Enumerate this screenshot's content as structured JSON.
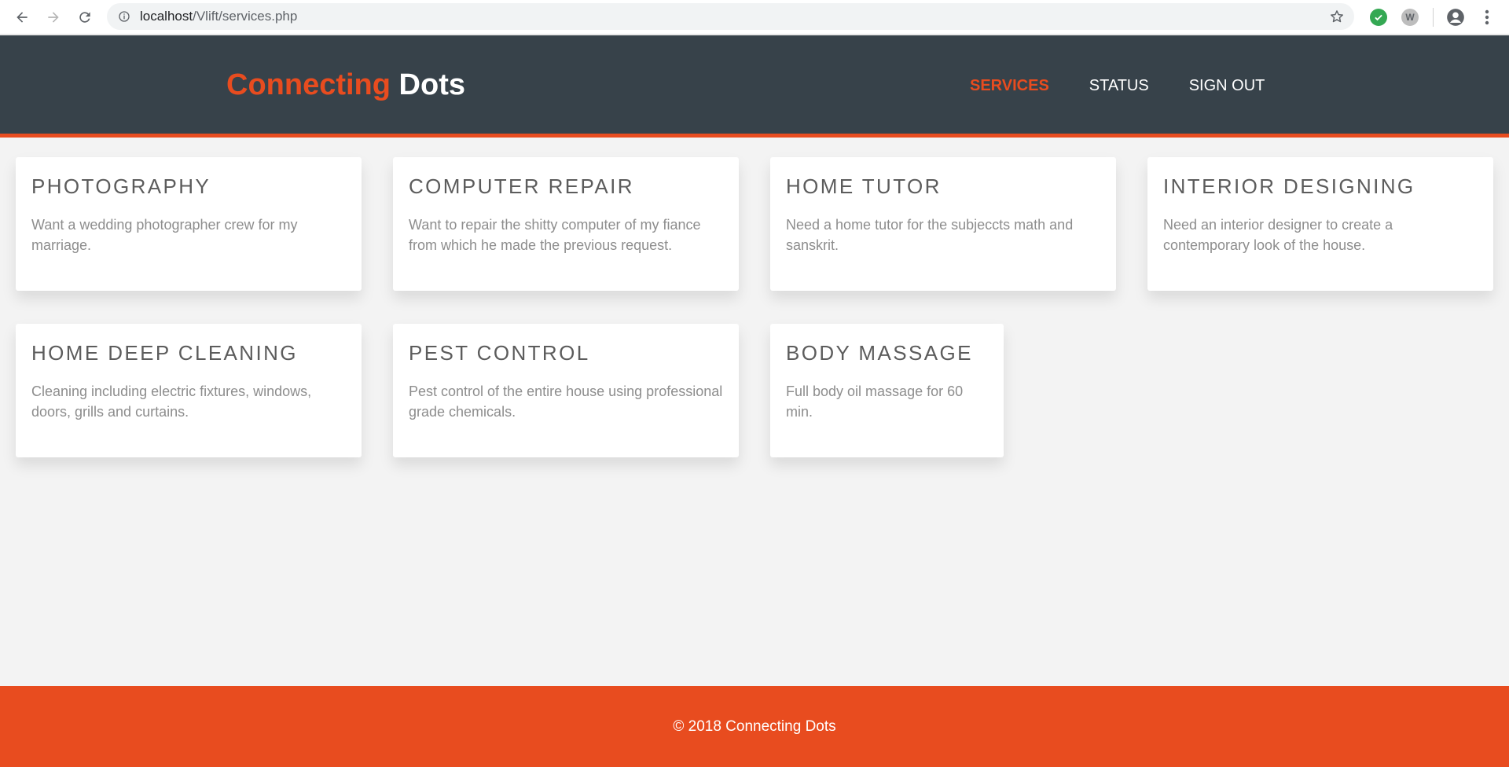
{
  "browser": {
    "url_host": "localhost",
    "url_path": "/Vlift/services.php",
    "extension_w_label": "W"
  },
  "site": {
    "brand_part1": "Connecting",
    "brand_part2": "Dots",
    "nav": [
      {
        "label": "SERVICES",
        "active": true
      },
      {
        "label": "STATUS",
        "active": false
      },
      {
        "label": "SIGN OUT",
        "active": false
      }
    ],
    "accent_color": "#e84c1f",
    "header_color": "#37424a"
  },
  "services": [
    {
      "title": "PHOTOGRAPHY",
      "description": "Want a wedding photographer crew for my marriage."
    },
    {
      "title": "COMPUTER REPAIR",
      "description": "Want to repair the shitty computer of my fiance from which he made the previous request."
    },
    {
      "title": "HOME TUTOR",
      "description": "Need a home tutor for the subjeccts math and sanskrit."
    },
    {
      "title": "INTERIOR DESIGNING",
      "description": "Need an interior designer to create a contemporary look of the house."
    },
    {
      "title": "HOME DEEP CLEANING",
      "description": "Cleaning including electric fixtures, windows, doors, grills and curtains."
    },
    {
      "title": "PEST CONTROL",
      "description": "Pest control of the entire house using professional grade chemicals."
    },
    {
      "title": "BODY MASSAGE",
      "description": "Full body oil massage for 60 min."
    }
  ],
  "footer": {
    "text": "© 2018 Connecting Dots"
  }
}
